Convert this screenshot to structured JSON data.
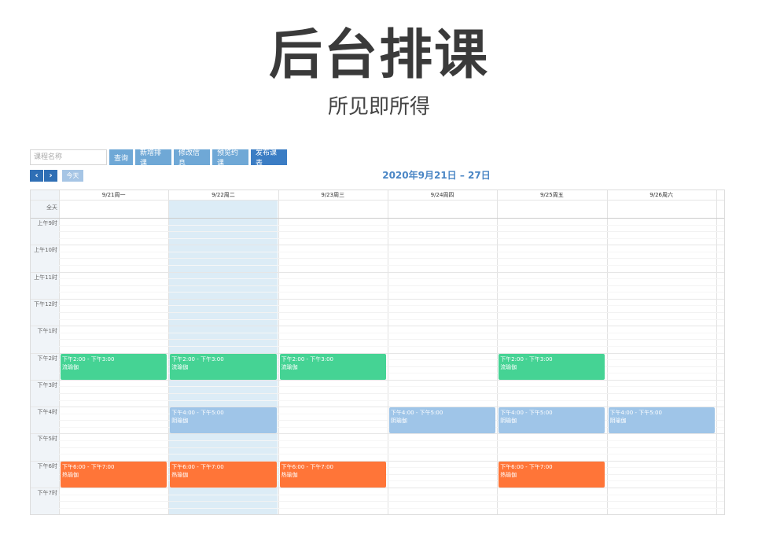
{
  "header": {
    "title": "后台排课",
    "subtitle": "所见即所得"
  },
  "toolbar": {
    "search_placeholder": "课程名称",
    "buttons": [
      {
        "label": "查询"
      },
      {
        "label": "新增排课"
      },
      {
        "label": "修改信息"
      },
      {
        "label": "预览约课"
      },
      {
        "label": "发布课表"
      }
    ]
  },
  "nav": {
    "prev": "‹",
    "next": "›",
    "today": "今天"
  },
  "calendar": {
    "range_title": "2020年9月21日 – 27日",
    "allday_label": "全天",
    "days": [
      "9/21周一",
      "9/22周二",
      "9/23周三",
      "9/24周四",
      "9/25周五",
      "9/26周六"
    ],
    "times": [
      "上午9时",
      "上午10时",
      "上午11时",
      "下午12时",
      "下午1时",
      "下午2时",
      "下午3时",
      "下午4时",
      "下午5时",
      "下午6时",
      "下午7时"
    ],
    "events": [
      {
        "day": 0,
        "time": "下午2:00 - 下午3:00",
        "name": "流瑜伽",
        "color": "#45d394"
      },
      {
        "day": 1,
        "time": "下午2:00 - 下午3:00",
        "name": "流瑜伽",
        "color": "#45d394"
      },
      {
        "day": 2,
        "time": "下午2:00 - 下午3:00",
        "name": "流瑜伽",
        "color": "#45d394"
      },
      {
        "day": 4,
        "time": "下午2:00 - 下午3:00",
        "name": "流瑜伽",
        "color": "#45d394"
      },
      {
        "day": 1,
        "time": "下午4:00 - 下午5:00",
        "name": "阴瑜伽",
        "color": "#9fc5e8"
      },
      {
        "day": 3,
        "time": "下午4:00 - 下午5:00",
        "name": "阴瑜伽",
        "color": "#9fc5e8"
      },
      {
        "day": 4,
        "time": "下午4:00 - 下午5:00",
        "name": "阴瑜伽",
        "color": "#9fc5e8"
      },
      {
        "day": 5,
        "time": "下午4:00 - 下午5:00",
        "name": "阴瑜伽",
        "color": "#9fc5e8"
      },
      {
        "day": 0,
        "time": "下午6:00 - 下午7:00",
        "name": "热瑜伽",
        "color": "#ff7538"
      },
      {
        "day": 1,
        "time": "下午6:00 - 下午7:00",
        "name": "热瑜伽",
        "color": "#ff7538"
      },
      {
        "day": 2,
        "time": "下午6:00 - 下午7:00",
        "name": "热瑜伽",
        "color": "#ff7538"
      },
      {
        "day": 4,
        "time": "下午6:00 - 下午7:00",
        "name": "热瑜伽",
        "color": "#ff7538"
      }
    ]
  }
}
